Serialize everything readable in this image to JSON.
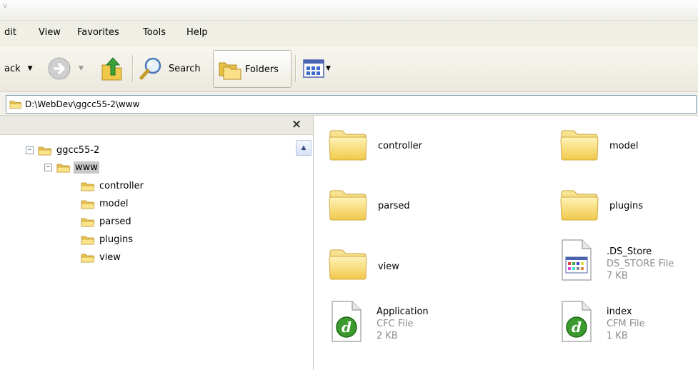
{
  "window": {
    "title_fragment": "v"
  },
  "menu": [
    "dit",
    "View",
    "Favorites",
    "Tools",
    "Help"
  ],
  "toolbar": {
    "back_label": "ack",
    "search_label": "Search",
    "folders_label": "Folders"
  },
  "address": {
    "path": "D:\\WebDev\\ggcc55-2\\www"
  },
  "tree": {
    "close_glyph": "×",
    "root": {
      "label": "ggcc55-2",
      "expander": "−"
    },
    "current": {
      "label": "www",
      "expander": "−"
    },
    "children": [
      "controller",
      "model",
      "parsed",
      "plugins",
      "view"
    ]
  },
  "files": [
    {
      "name": "controller",
      "type": "",
      "size": "",
      "icon": "folder-icon"
    },
    {
      "name": "model",
      "type": "",
      "size": "",
      "icon": "folder-icon"
    },
    {
      "name": "parsed",
      "type": "",
      "size": "",
      "icon": "folder-icon"
    },
    {
      "name": "plugins",
      "type": "",
      "size": "",
      "icon": "folder-icon"
    },
    {
      "name": "view",
      "type": "",
      "size": "",
      "icon": "folder-icon"
    },
    {
      "name": ".DS_Store",
      "type": "DS_STORE File",
      "size": "7 KB",
      "icon": "generic-file-icon"
    },
    {
      "name": "Application",
      "type": "CFC File",
      "size": "2 KB",
      "icon": "dreamweaver-file-icon"
    },
    {
      "name": "index",
      "type": "CFM File",
      "size": "1 KB",
      "icon": "dreamweaver-file-icon"
    }
  ],
  "colors": {
    "selection": "#c8c8c8",
    "folder": "#f6d76a",
    "dw_green": "#3a9a2e"
  }
}
